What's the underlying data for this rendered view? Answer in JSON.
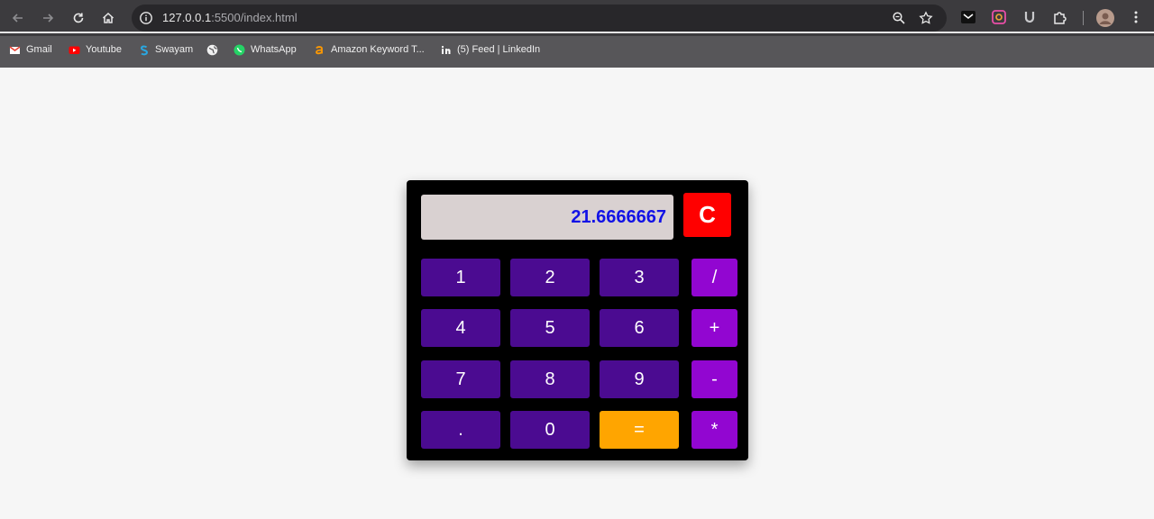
{
  "browser": {
    "url_host": "127.0.0.1",
    "url_rest": ":5500/index.html",
    "bookmarks": [
      {
        "label": "Gmail",
        "icon": "gmail-icon"
      },
      {
        "label": "Youtube",
        "icon": "youtube-icon"
      },
      {
        "label": "Swayam",
        "icon": "swayam-icon"
      },
      {
        "label": "",
        "icon": "globe-icon"
      },
      {
        "label": "WhatsApp",
        "icon": "whatsapp-icon"
      },
      {
        "label": "Amazon Keyword T...",
        "icon": "amazon-icon"
      },
      {
        "label": "(5) Feed | LinkedIn",
        "icon": "linkedin-icon"
      }
    ]
  },
  "calculator": {
    "display_value": "21.6666667",
    "clear_label": "C",
    "rows": [
      {
        "keys": [
          "1",
          "2",
          "3"
        ],
        "op": "/"
      },
      {
        "keys": [
          "4",
          "5",
          "6"
        ],
        "op": "+"
      },
      {
        "keys": [
          "7",
          "8",
          "9"
        ],
        "op": "-"
      },
      {
        "keys": [
          ".",
          "0",
          "="
        ],
        "op": "*"
      }
    ]
  },
  "colors": {
    "display_text": "#1212e6",
    "digit_key": "#4b0b91",
    "operator_key": "#9206d1",
    "equals_key": "#ffa500",
    "clear_key": "#ff0000",
    "calculator_body": "#000000"
  }
}
